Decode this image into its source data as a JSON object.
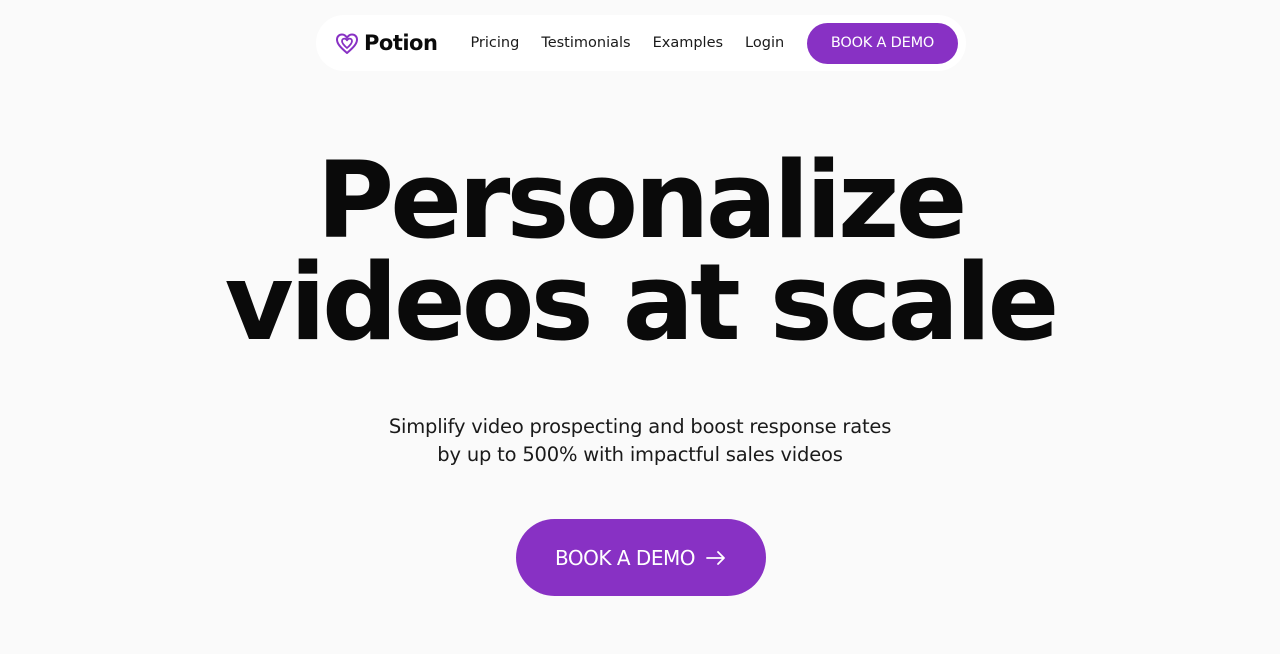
{
  "brand": {
    "name": "Potion",
    "logo_icon": "potion-heart-icon",
    "accent_color": "#8831c4"
  },
  "nav": {
    "links": [
      {
        "label": "Pricing"
      },
      {
        "label": "Testimonials"
      },
      {
        "label": "Examples"
      },
      {
        "label": "Login"
      }
    ],
    "cta_label": "BOOK A DEMO"
  },
  "hero": {
    "title_line1": "Personalize",
    "title_line2": "videos at scale",
    "subtitle_line1": "Simplify video prospecting and boost response rates",
    "subtitle_line2": "by up to 500% with impactful sales videos",
    "cta_label": "BOOK A DEMO",
    "cta_icon": "arrow-right-icon"
  }
}
